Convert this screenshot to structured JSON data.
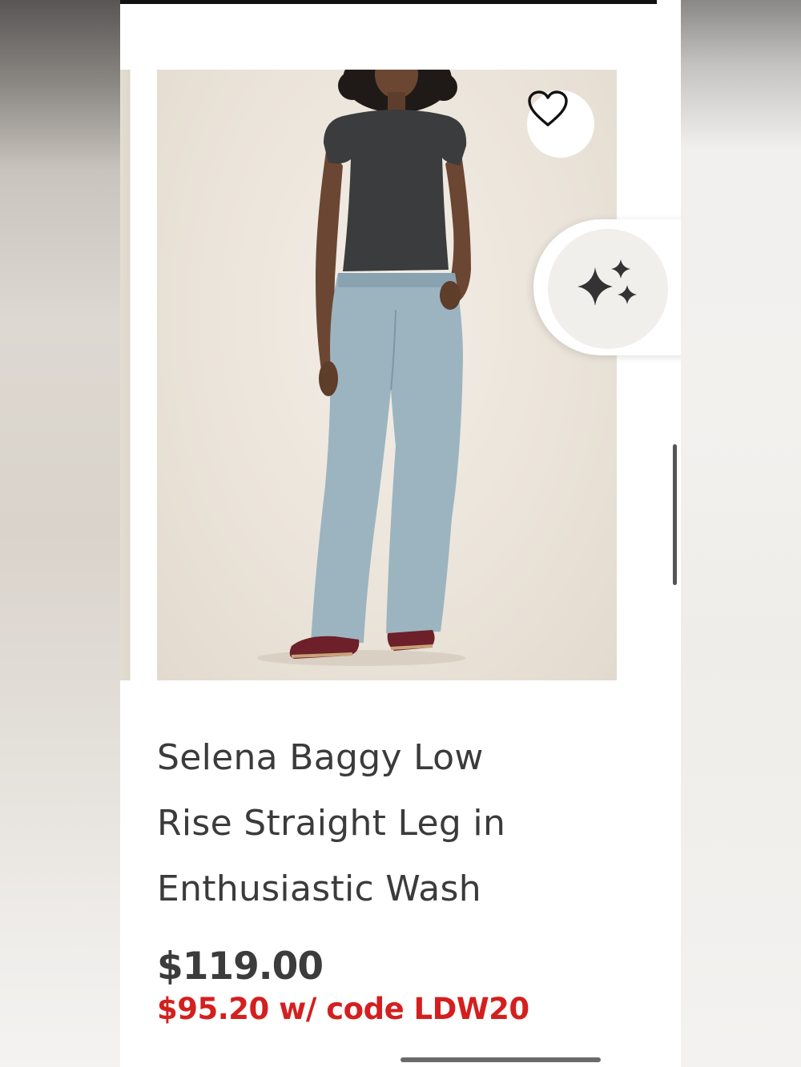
{
  "product": {
    "title_lines": [
      "Selena Baggy Low",
      "Rise Straight Leg in",
      "Enthusiastic Wash"
    ],
    "price": "$119.00",
    "promo_price": "$95.20 w/ code LDW20"
  },
  "icons": {
    "favorite": "heart-outline-icon",
    "ai_assistant": "sparkles-icon"
  },
  "colors": {
    "promo": "#d3201f",
    "text": "#3b3b3b",
    "image_background": "#ebe4da"
  }
}
